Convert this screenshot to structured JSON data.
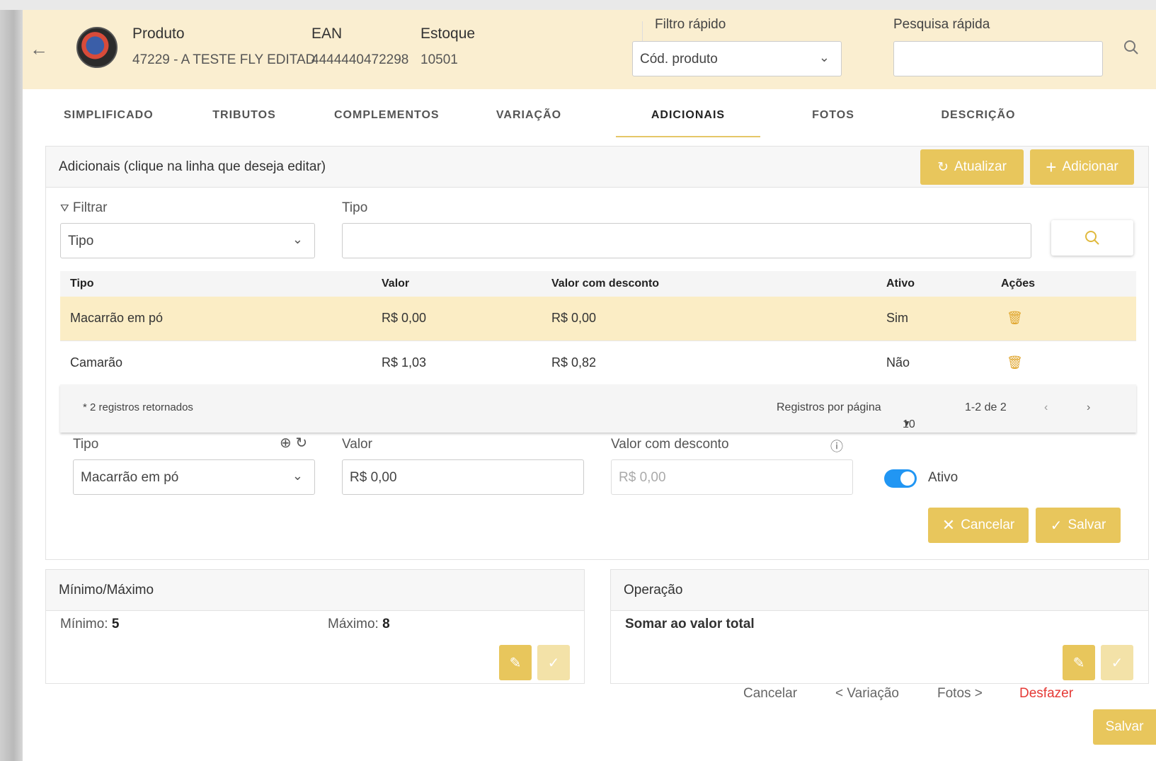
{
  "header": {
    "product_label": "Produto",
    "product_value": "47229 - A TESTE FLY EDITAD",
    "ean_label": "EAN",
    "ean_value": "4444440472298",
    "stock_label": "Estoque",
    "stock_value": "10501",
    "quick_filter_label": "Filtro rápido",
    "quick_filter_value": "Cód. produto",
    "quick_search_label": "Pesquisa rápida",
    "quick_search_value": ""
  },
  "tabs": [
    {
      "label": "SIMPLIFICADO"
    },
    {
      "label": "TRIBUTOS"
    },
    {
      "label": "COMPLEMENTOS"
    },
    {
      "label": "VARIAÇÃO"
    },
    {
      "label": "ADICIONAIS",
      "active": true
    },
    {
      "label": "FOTOS"
    },
    {
      "label": "DESCRIÇÃO"
    }
  ],
  "additionals": {
    "title": "Adicionais (clique na linha que deseja editar)",
    "refresh_label": "Atualizar",
    "add_label": "Adicionar",
    "filter_label": "Filtrar",
    "filter_value": "Tipo",
    "type_label": "Tipo",
    "type_search_value": "",
    "columns": [
      "Tipo",
      "Valor",
      "Valor com desconto",
      "Ativo",
      "Ações"
    ],
    "rows": [
      {
        "tipo": "Macarrão em pó",
        "valor": "R$ 0,00",
        "desconto": "R$ 0,00",
        "ativo": "Sim",
        "selected": true
      },
      {
        "tipo": "Camarão",
        "valor": "R$ 1,03",
        "desconto": "R$ 0,82",
        "ativo": "Não",
        "selected": false
      }
    ],
    "records_returned": "* 2 registros retornados",
    "per_page_label": "Registros por página",
    "per_page_value": "10",
    "range_label": "1-2 de 2"
  },
  "edit_form": {
    "type_label": "Tipo",
    "type_value": "Macarrão em pó",
    "value_label": "Valor",
    "value_value": "R$ 0,00",
    "discount_label": "Valor com desconto",
    "discount_value": "R$ 0,00",
    "active_label": "Ativo",
    "active_on": true,
    "cancel_label": "Cancelar",
    "save_label": "Salvar"
  },
  "minmax": {
    "title": "Mínimo/Máximo",
    "min_label": "Mínimo:",
    "min_value": "5",
    "max_label": "Máximo:",
    "max_value": "8"
  },
  "operation": {
    "title": "Operação",
    "value": "Somar ao valor total"
  },
  "footer": {
    "cancel": "Cancelar",
    "prev": "< Variação",
    "next": "Fotos >",
    "undo": "Desfazer",
    "save": "Salvar"
  },
  "colors": {
    "accent": "#e8c65c",
    "header_bg": "#faeed0",
    "selected_row": "#fbedc5",
    "toggle": "#2196f3",
    "undo": "#e53935"
  }
}
